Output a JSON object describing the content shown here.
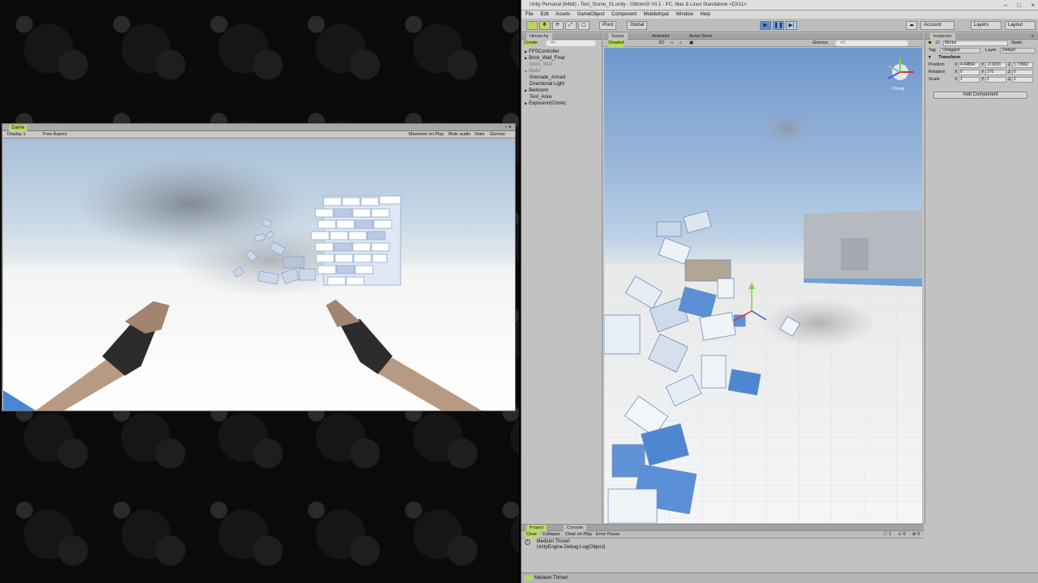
{
  "game_window": {
    "tab_label": "Game",
    "close_glyphs": "▫ ×",
    "display": "Display 1",
    "aspect": "Free Aspect",
    "toolbar_buttons": [
      "Maximize on Play",
      "Mute audio",
      "Stats",
      "Gizmos"
    ]
  },
  "editor": {
    "title": "Unity Personal (64bit) - Test_Scene_01.unity - GMonnG V0.1 - PC, Mac & Linux Standalone <DX11>",
    "window_controls": [
      "–",
      "□",
      "×"
    ],
    "menu": [
      "File",
      "Edit",
      "Assets",
      "GameObject",
      "Component",
      "MobileInput",
      "Window",
      "Help"
    ],
    "toolbar": {
      "pivot": "Pivot",
      "global": "Global",
      "play": "▶",
      "pause": "❚❚",
      "step": "▶|",
      "account": "Account",
      "layers": "Layers",
      "layout": "Layout",
      "cloud": "☁"
    }
  },
  "hierarchy": {
    "tab": "Hierarchy",
    "create": "Create",
    "search_placeholder": "All",
    "items": [
      "FPSController",
      "Brick_Wall_Final",
      "Brick_Wall",
      "Wall2",
      "Grenade_Armed",
      "Directional Light",
      "Bedroom",
      "Test_Area",
      "Explosion(Clone)"
    ]
  },
  "scene": {
    "tabs": [
      "Scene",
      "Animator",
      "Asset Store"
    ],
    "shaded": "Shaded",
    "mode_2d": "2D",
    "gizmos": "Gizmos",
    "search_placeholder": "All",
    "persp": "< Persp"
  },
  "inspector": {
    "tab": "Inspector",
    "object_name": "Mortar",
    "static_label": "Static",
    "tag_label": "Tag",
    "tag_value": "Untagged",
    "layer_label": "Layer",
    "layer_value": "Default",
    "transform": "Transform",
    "position": {
      "label": "Position",
      "x": "4.44894",
      "y": "-2.0033",
      "z": "1.73962"
    },
    "rotation": {
      "label": "Rotation",
      "x": "0",
      "y": "270",
      "z": "0"
    },
    "scale": {
      "label": "Scale",
      "x": "1",
      "y": "1",
      "z": "1"
    },
    "add_component": "Add Component"
  },
  "console": {
    "tabs": [
      "Project",
      "Console"
    ],
    "buttons": [
      "Clear",
      "Collapse",
      "Clear on Play",
      "Error Pause"
    ],
    "counts": [
      "1",
      "0",
      "0"
    ],
    "message_line1": "Medium Throw!",
    "message_line2": "UnityEngine.Debug:Log(Object)"
  },
  "status_bar": "Medium Throw!",
  "colors": {
    "highlight": "#b9d86a",
    "panel": "#c2c2c2",
    "sky": "#9bb8db"
  }
}
